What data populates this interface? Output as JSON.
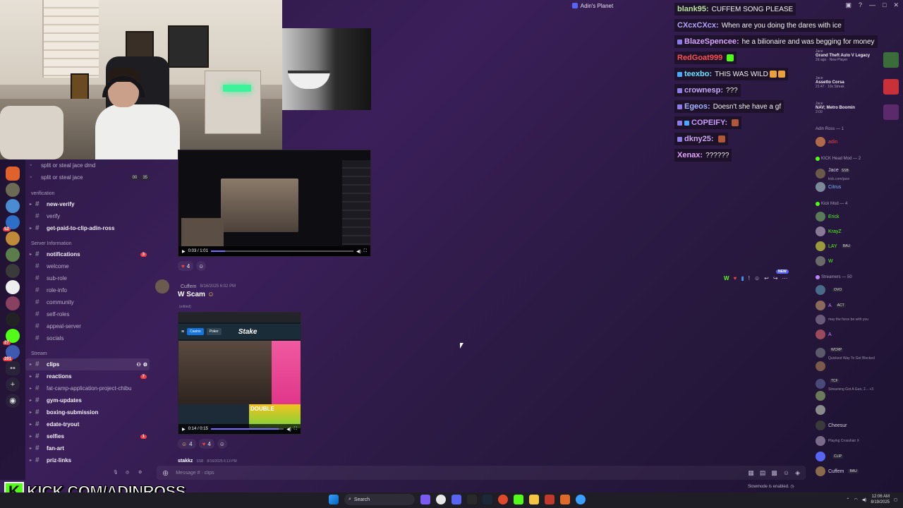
{
  "window": {
    "title": "Adin's Planet"
  },
  "sidebar": {
    "top_items": [
      {
        "label": "split or steal jace dmd"
      },
      {
        "label": "split or steal jace",
        "pills": [
          "00",
          "35"
        ]
      }
    ],
    "categories": {
      "verification": "verification",
      "server_information": "Server Information",
      "stream": "Stream"
    },
    "verification_items": [
      {
        "label": "new-verify"
      },
      {
        "label": "verify"
      },
      {
        "label": "get-paid-to-clip-adin-ross"
      }
    ],
    "server_items": [
      {
        "label": "notifications",
        "mention": "3"
      },
      {
        "label": "welcome"
      },
      {
        "label": "sub-role"
      },
      {
        "label": "role-info"
      },
      {
        "label": "community"
      },
      {
        "label": "self-roles"
      },
      {
        "label": "appeal-server"
      },
      {
        "label": "socials"
      }
    ],
    "stream_items": [
      {
        "label": "clips"
      },
      {
        "label": "reactions",
        "mention": "7"
      },
      {
        "label": "fat-camp-application-project-chibu"
      },
      {
        "label": "gym-updates"
      },
      {
        "label": "boxing-submission"
      },
      {
        "label": "edate-tryout"
      },
      {
        "label": "selfies",
        "mention": "1"
      },
      {
        "label": "fan-art"
      },
      {
        "label": "priz-links"
      }
    ],
    "server_badges": [
      "52",
      "27",
      "201"
    ]
  },
  "messages": {
    "video1": {
      "time": "0:03 / 1:01",
      "reaction_count": "4"
    },
    "cuffem": {
      "author": "Cuffem",
      "timestamp": "8/16/2025 6:02 PM",
      "text": "W Scam",
      "edited": "(edited)",
      "video_time": "0:14 / 0:15",
      "reactions": [
        "4",
        "4"
      ],
      "stake": {
        "brand": "Stake",
        "casino": "Casino",
        "sports": "Poker",
        "double": "DOUBLE"
      }
    },
    "stakkz": {
      "author": "stakkz",
      "tag": "SSB",
      "timestamp": "8/16/2025 6:13 PM"
    },
    "toolbar_new": "NEW"
  },
  "composer": {
    "placeholder": "Message # · clips",
    "slowmode": "Slowmode is enabled."
  },
  "overlay_chat": [
    {
      "user": "blank95:",
      "msg": "CUFFEM SONG PLEASE",
      "color": "#b8e0a0"
    },
    {
      "user": "CXcxCXcx:",
      "msg": "When are you doing the dares with ice",
      "color": "#b7a6ff"
    },
    {
      "user": "BlazeSpencee:",
      "msg": "he a bilionaire and was begging for money",
      "color": "#d6a5ff"
    },
    {
      "user": "RedGoat999",
      "msg": "",
      "color": "#ff4f4f"
    },
    {
      "user": "teexbo:",
      "msg": "THIS WAS WILD",
      "color": "#6fe2ff"
    },
    {
      "user": "crownesp:",
      "msg": "???",
      "color": "#c8a8ff"
    },
    {
      "user": "Egeos:",
      "msg": "Doesn't she have a gf",
      "color": "#a7b4ff"
    },
    {
      "user": "COPEIFY:",
      "msg": "",
      "color": "#c89cff"
    },
    {
      "user": "dkny25:",
      "msg": "",
      "color": "#c9a8f2"
    },
    {
      "user": "Xenax:",
      "msg": "??????",
      "color": "#e3a2ff"
    }
  ],
  "activities": [
    {
      "user": "Jace",
      "game": "Grand Theft Auto V Legacy",
      "status": "2d ago · New Player"
    },
    {
      "user": "Jace",
      "game": "Assetto Corsa",
      "status": "21:47 · 10x Streak"
    },
    {
      "user": "Jace",
      "game": "NAV; Metro Boomin",
      "status": "2:09"
    }
  ],
  "members": {
    "sections": {
      "adin": "Adin Ross — 1",
      "head_mod": "KICK Head Mod — 2",
      "kick_mod": "Kick Mod — 4",
      "streamers": "Streamers — 50"
    },
    "head_mods": [
      {
        "name": "Jace",
        "tag": "SSB",
        "sub": "kick.com/jace"
      },
      {
        "name": "Citrus",
        "sub": ""
      }
    ],
    "kick_mods": [
      {
        "name": "Erick",
        "tag": ""
      },
      {
        "name": "KrayZ",
        "tag": ""
      },
      {
        "name": "LAY",
        "tag": "BAU"
      },
      {
        "name": "W",
        "tag": ""
      }
    ],
    "streamers": [
      {
        "name": "",
        "tag": "OVO",
        "sub": ""
      },
      {
        "name": "A",
        "tag": "ACT",
        "sub": ""
      },
      {
        "name": "",
        "tag": "",
        "sub": "may the force be with you"
      },
      {
        "name": "A",
        "tag": "",
        "sub": ""
      },
      {
        "name": "",
        "tag": "WCRP",
        "sub": "Quickest Way To Get Blocked"
      },
      {
        "name": "",
        "tag": "",
        "sub": ""
      },
      {
        "name": "",
        "tag": "TCF",
        "sub": "Streaming Got A Gun, 2... +3"
      },
      {
        "name": "",
        "tag": "",
        "sub": ""
      },
      {
        "name": "",
        "tag": "",
        "sub": ""
      },
      {
        "name": "Cheesur",
        "tag": "",
        "sub": ""
      },
      {
        "name": "",
        "tag": "",
        "sub": "Playing Crosshair X"
      },
      {
        "name": "",
        "tag": "CLIP",
        "sub": ""
      },
      {
        "name": "Cuffem",
        "tag": "BAU",
        "sub": ""
      }
    ]
  },
  "watermark": {
    "letter": "K",
    "text": "KICK.COM/ADINROSS"
  },
  "taskbar": {
    "search": "Search",
    "time": "12:06 AM",
    "date": "8/19/2025"
  },
  "colors": {
    "accent": "#5865f2",
    "kick_green": "#53fc18",
    "mention": "#f23f43"
  }
}
